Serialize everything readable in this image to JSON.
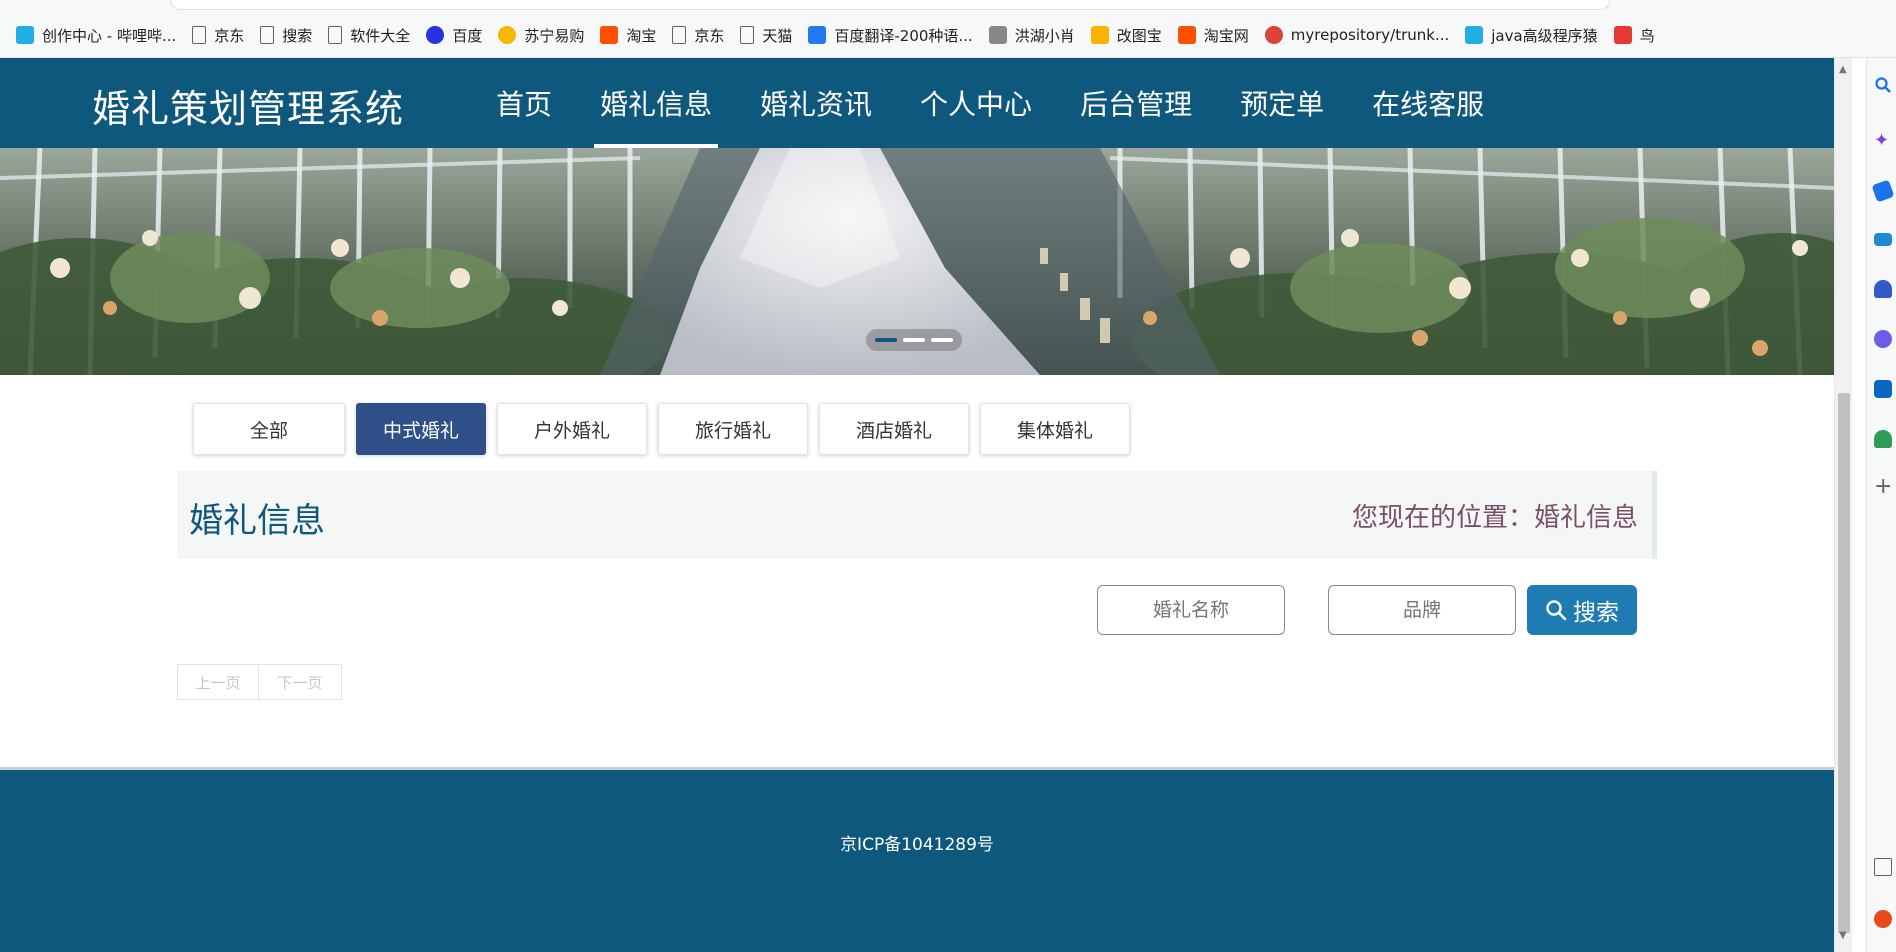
{
  "bookmarks": [
    {
      "label": "创作中心 - 哔哩哔...",
      "icon": "bilibili-icon",
      "color": "#23ade5"
    },
    {
      "label": "京东",
      "icon": "page-icon"
    },
    {
      "label": "搜索",
      "icon": "page-icon"
    },
    {
      "label": "软件大全",
      "icon": "page-icon"
    },
    {
      "label": "百度",
      "icon": "baidu-paw-icon",
      "color": "#2932e1"
    },
    {
      "label": "苏宁易购",
      "icon": "suning-icon",
      "color": "#f5b800"
    },
    {
      "label": "淘宝",
      "icon": "taobao-icon",
      "color": "#ff5000"
    },
    {
      "label": "京东",
      "icon": "page-icon"
    },
    {
      "label": "天猫",
      "icon": "page-icon"
    },
    {
      "label": "百度翻译-200种语...",
      "icon": "translate-icon",
      "color": "#1f7bef"
    },
    {
      "label": "洪湖小肖",
      "icon": "bird-icon",
      "color": "#888888"
    },
    {
      "label": "改图宝",
      "icon": "gaitubao-icon",
      "color": "#ffb300"
    },
    {
      "label": "淘宝网",
      "icon": "taobao-icon",
      "color": "#ff5000"
    },
    {
      "label": "myrepository/trunk...",
      "icon": "chrome-icon",
      "color": "#db4437"
    },
    {
      "label": "java高级程序猿",
      "icon": "bilibili-icon",
      "color": "#23ade5"
    },
    {
      "label": "鸟",
      "icon": "swallow-icon",
      "color": "#e53935"
    }
  ],
  "site": {
    "title": "婚礼策划管理系统",
    "nav": [
      "首页",
      "婚礼信息",
      "婚礼资讯",
      "个人中心",
      "后台管理",
      "预定单",
      "在线客服"
    ],
    "active_nav": 1,
    "header_color": "#0e587e"
  },
  "categories": [
    "全部",
    "中式婚礼",
    "户外婚礼",
    "旅行婚礼",
    "酒店婚礼",
    "集体婚礼"
  ],
  "active_category": 1,
  "section": {
    "title": "婚礼信息",
    "breadcrumb": "您现在的位置：婚礼信息"
  },
  "search": {
    "name_placeholder": "婚礼名称",
    "brand_placeholder": "品牌",
    "button_label": "搜索"
  },
  "pager": {
    "prev": "上一页",
    "next": "下一页"
  },
  "footer": {
    "icp": "京ICP备1041289号"
  }
}
